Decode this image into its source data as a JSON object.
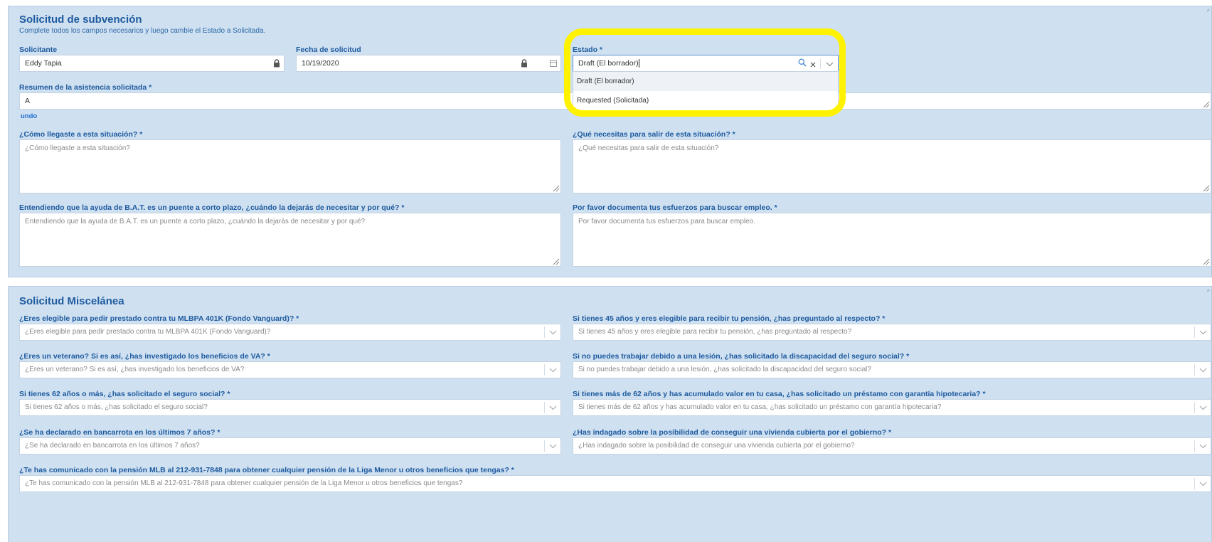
{
  "grant": {
    "title": "Solicitud de subvención",
    "subtitle": "Complete todos los campos necesarios y luego cambie el Estado a Solicitada.",
    "applicant": {
      "label": "Solicitante",
      "value": "Eddy Tapia"
    },
    "date": {
      "label": "Fecha de solicitud",
      "value": "10/19/2020"
    },
    "status": {
      "label": "Estado *",
      "value": "Draft (El borrador)",
      "options": [
        "Draft (El borrador)",
        "Requested (Solicitada)"
      ]
    },
    "summary": {
      "label": "Resumen de la asistencia solicitada *",
      "value": "A",
      "undo": "undo"
    },
    "how": {
      "label": "¿Cómo llegaste a esta situación? *",
      "placeholder": "¿Cómo llegaste a esta situación?"
    },
    "need": {
      "label": "¿Qué necesitas para salir de esta situación? *",
      "placeholder": "¿Qué necesitas para salir de esta situación?"
    },
    "bridge": {
      "label": "Entendiendo que la ayuda de B.A.T. es un puente a corto plazo, ¿cuándo la dejarás de necesitar y por qué? *",
      "placeholder": "Entendiendo que la ayuda de B.A.T. es un puente a corto plazo, ¿cuándo la dejarás de necesitar y por qué?"
    },
    "job": {
      "label": "Por favor documenta tus esfuerzos para buscar empleo. *",
      "placeholder": "Por favor documenta tus esfuerzos para buscar empleo."
    }
  },
  "misc": {
    "title": "Solicitud Miscelánea",
    "fields": [
      {
        "label": "¿Eres elegible para pedir prestado contra tu MLBPA 401K (Fondo Vanguard)? *",
        "placeholder": "¿Eres elegible para pedir prestado contra tu MLBPA 401K (Fondo Vanguard)?"
      },
      {
        "label": "Si tienes 45 años y eres elegible para recibir tu pensión, ¿has preguntado al respecto? *",
        "placeholder": "Si tienes 45 años y eres elegible para recibir tu pensión, ¿has preguntado al respecto?"
      },
      {
        "label": "¿Eres un veterano? Si es así, ¿has investigado los beneficios de VA? *",
        "placeholder": "¿Eres un veterano? Si es así, ¿has investigado los beneficios de VA?"
      },
      {
        "label": "Si no puedes trabajar debido a una lesión, ¿has solicitado la discapacidad del seguro social? *",
        "placeholder": "Si no puedes trabajar debido a una lesión, ¿has solicitado la discapacidad del seguro social?"
      },
      {
        "label": "Si tienes 62 años o más, ¿has solicitado el seguro social? *",
        "placeholder": "Si tienes 62 años o más, ¿has solicitado el seguro social?"
      },
      {
        "label": "Si tienes más de 62 años y has acumulado valor en tu casa, ¿has solicitado un préstamo con garantía hipotecaria? *",
        "placeholder": "Si tienes más de 62 años y has acumulado valor en tu casa, ¿has solicitado un préstamo con garantía hipotecaria?"
      },
      {
        "label": "¿Se ha declarado en bancarrota en los últimos 7 años? *",
        "placeholder": "¿Se ha declarado en bancarrota en los últimos 7 años?"
      },
      {
        "label": "¿Has indagado sobre la posibilidad de conseguir una vivienda cubierta por el gobierno? *",
        "placeholder": "¿Has indagado sobre la posibilidad de conseguir una vivienda cubierta por el gobierno?"
      },
      {
        "label": "¿Te has comunicado con la pensión MLB al 212-931-7848 para obtener cualquier pensión de la Liga Menor u otros beneficios que tengas? *",
        "placeholder": "¿Te has comunicado con la pensión MLB al 212-931-7848 para obtener cualquier pensión de la Liga Menor u otros beneficios que tengas?"
      }
    ]
  },
  "colors": {
    "panel": "#cfe0f1",
    "label": "#1d5a9e",
    "highlight": "#fff200",
    "link": "#1d6fd0"
  },
  "icons": [
    "lock-icon",
    "calendar-icon",
    "search-icon",
    "clear-icon",
    "chevron-down-icon",
    "resize-grip-icon"
  ]
}
